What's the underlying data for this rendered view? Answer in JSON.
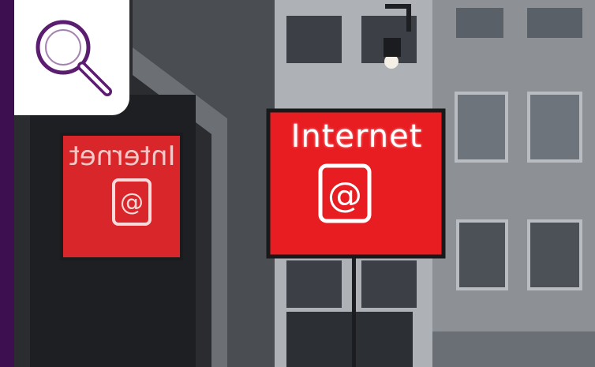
{
  "search_tile": {
    "icon": "search-icon"
  },
  "photo": {
    "sign_text": "Internet",
    "sign_symbol": "@",
    "reflection_text": "Internet",
    "reflection_symbol": "@"
  },
  "colors": {
    "purple": "#3d0e50",
    "tile": "#ffffff",
    "sign_red": "#e81d22",
    "building_gray": "#8d9196"
  }
}
